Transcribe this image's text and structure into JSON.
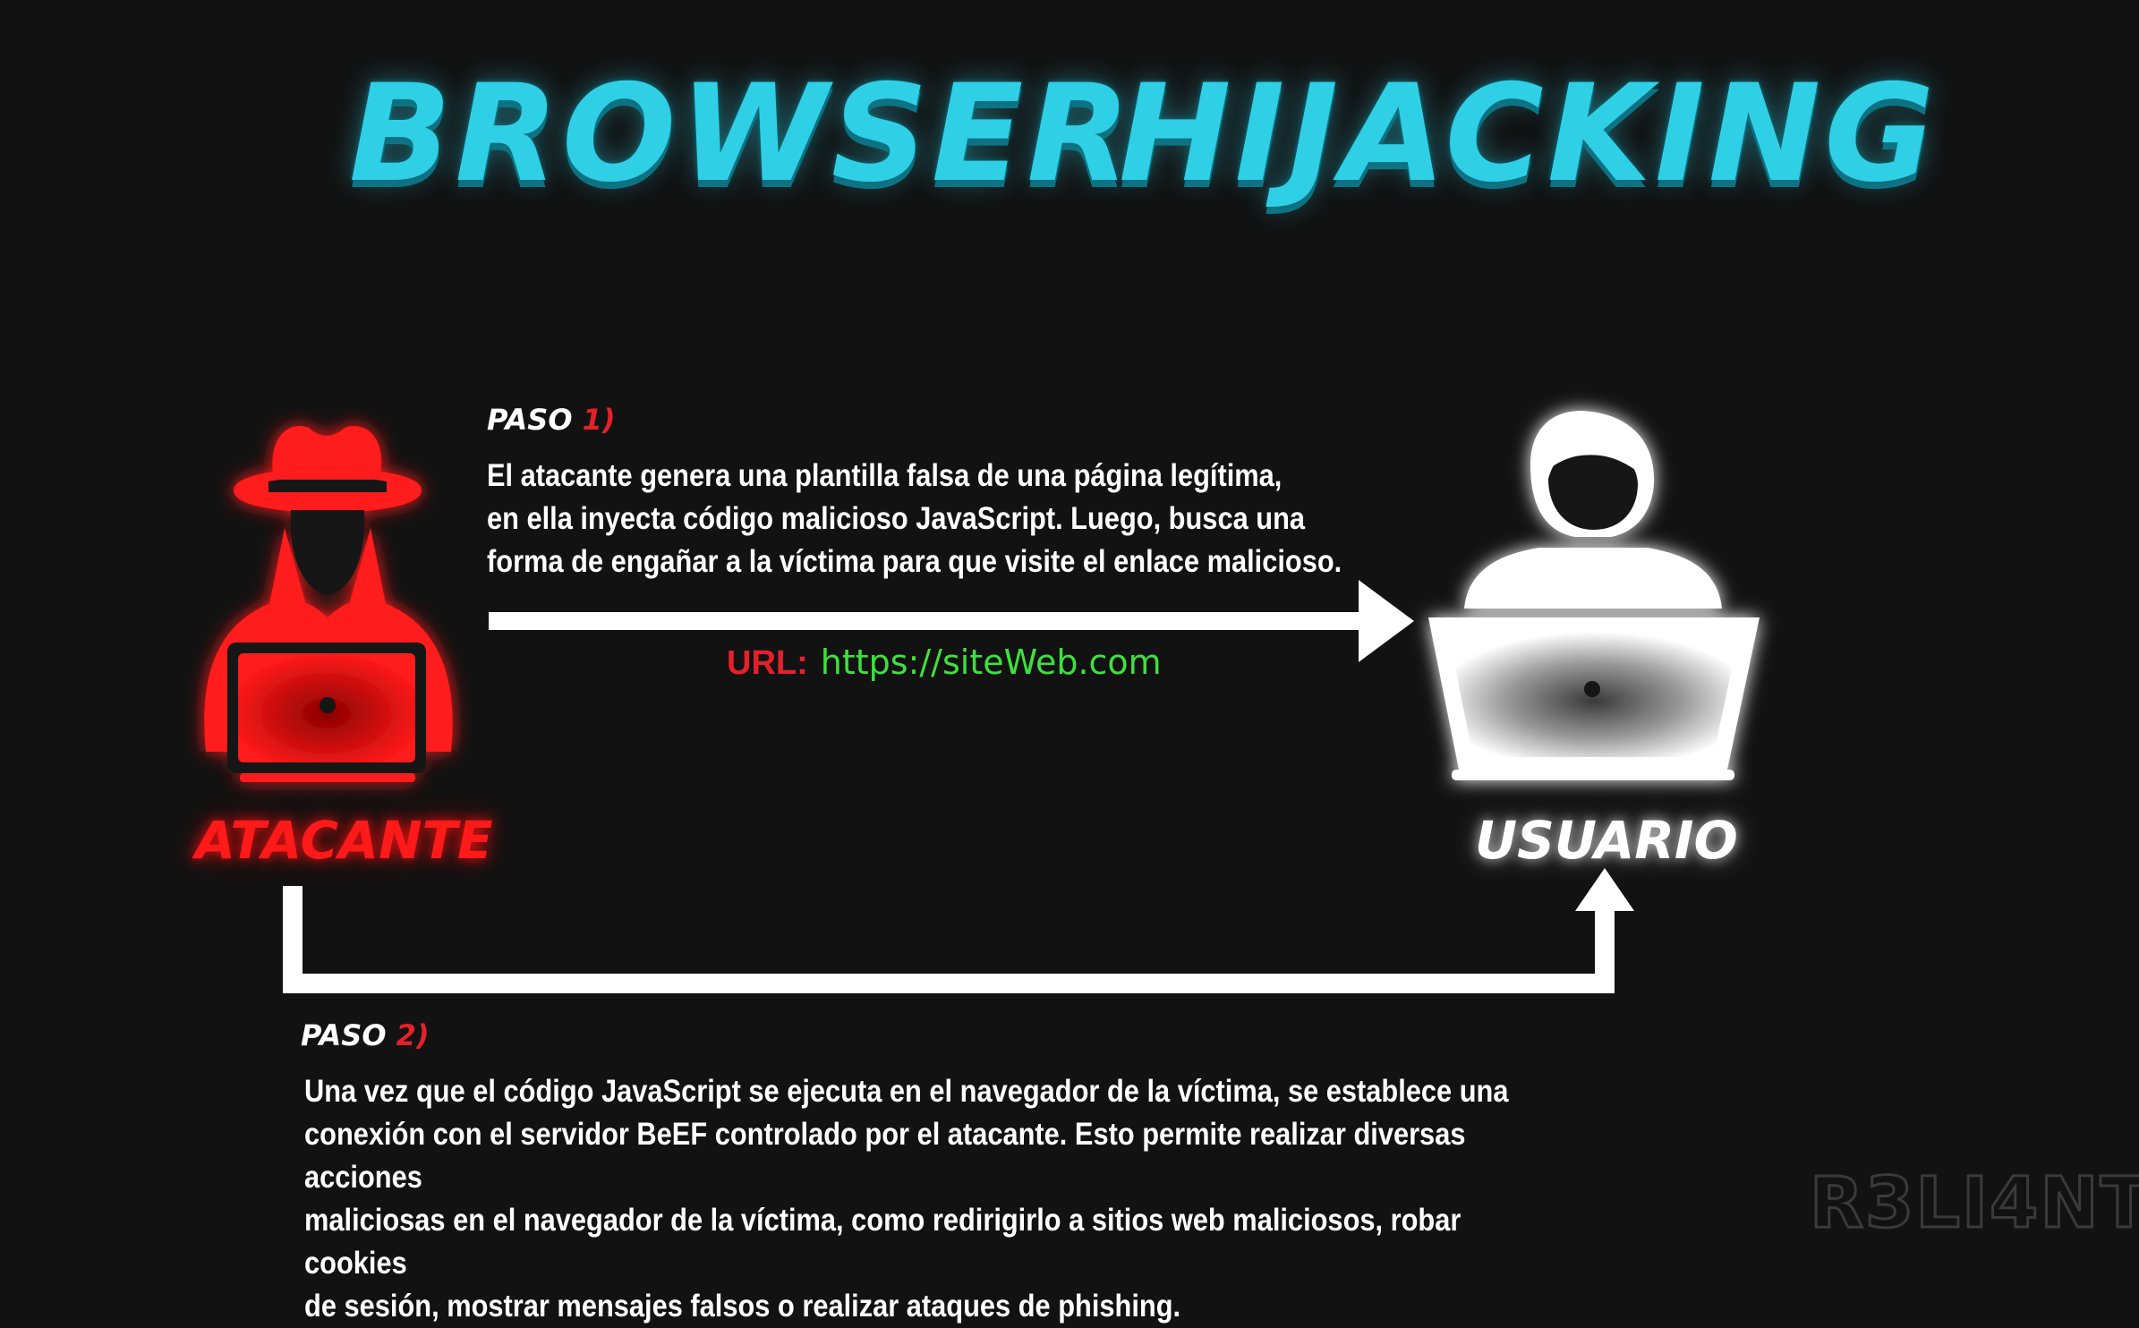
{
  "title": {
    "word1": "BROWSER",
    "word2": "HIJACKING"
  },
  "step1": {
    "label": "PASO",
    "number": "1)",
    "text": "El atacante genera una plantilla falsa de una página legítima,\nen ella inyecta código malicioso JavaScript. Luego, busca una\nforma de engañar a la víctima para que visite el enlace malicioso."
  },
  "url": {
    "label": "URL:",
    "value": "https://siteWeb.com"
  },
  "attacker": {
    "label": "ATACANTE",
    "icon": "hacker-with-laptop-icon",
    "color": "#ff1a1a"
  },
  "user": {
    "label": "USUARIO",
    "icon": "user-with-laptop-icon",
    "color": "#ffffff"
  },
  "step2": {
    "label": "PASO",
    "number": "2)",
    "text": "Una vez que el código JavaScript se ejecuta en el navegador de la víctima, se establece una\nconexión con el servidor BeEF controlado por el atacante. Esto permite realizar diversas acciones\nmaliciosas en el navegador de la víctima, como redirigirlo a sitios web maliciosos, robar cookies\nde sesión, mostrar mensajes falsos o realizar ataques de phishing."
  },
  "watermark": "R3LI4NT",
  "colors": {
    "background": "#121212",
    "title": "#2fd0e6",
    "accent_red": "#e3212b",
    "url_green": "#3ee03e"
  }
}
